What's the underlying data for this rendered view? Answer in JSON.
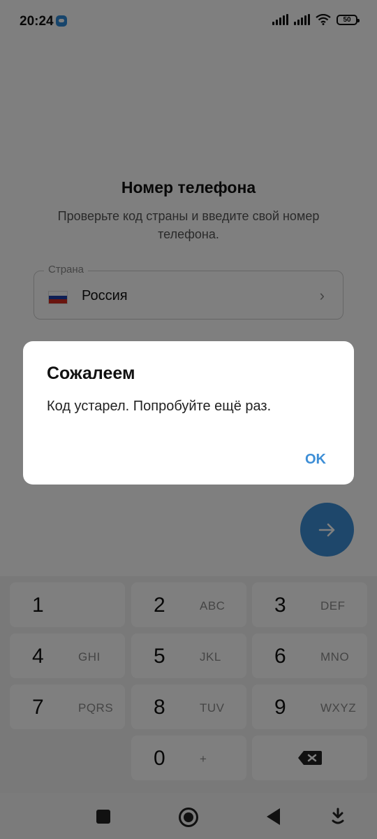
{
  "status_bar": {
    "time": "20:24",
    "battery": "50"
  },
  "screen": {
    "title": "Номер телефона",
    "subtitle": "Проверьте код страны и введите свой номер телефона.",
    "country_field": {
      "label": "Страна",
      "value": "Россия"
    },
    "next_button_icon": "arrow-right-icon"
  },
  "keypad": {
    "keys": [
      {
        "num": "1",
        "letters": ""
      },
      {
        "num": "2",
        "letters": "ABC"
      },
      {
        "num": "3",
        "letters": "DEF"
      },
      {
        "num": "4",
        "letters": "GHI"
      },
      {
        "num": "5",
        "letters": "JKL"
      },
      {
        "num": "6",
        "letters": "MNO"
      },
      {
        "num": "7",
        "letters": "PQRS"
      },
      {
        "num": "8",
        "letters": "TUV"
      },
      {
        "num": "9",
        "letters": "WXYZ"
      },
      {
        "num": "0",
        "letters": "+"
      }
    ]
  },
  "dialog": {
    "title": "Сожалеем",
    "message": "Код устарел. Попробуйте ещё раз.",
    "ok_label": "OK"
  },
  "colors": {
    "accent": "#3d8ed6",
    "overlay": "rgba(0,0,0,0.5)"
  }
}
